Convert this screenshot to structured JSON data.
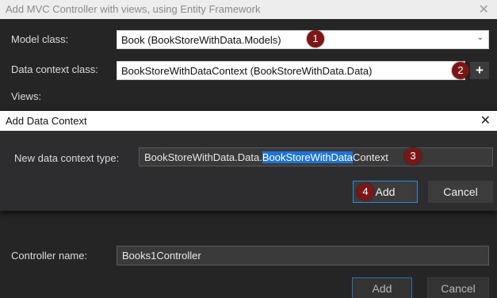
{
  "outer_dialog": {
    "title": "Add MVC Controller with views, using Entity Framework",
    "close_glyph": "✕",
    "model_class_label": "Model class:",
    "model_class_value": "Book (BookStoreWithData.Models)",
    "data_context_label": "Data context class:",
    "data_context_value": "BookStoreWithDataContext (BookStoreWithData.Data)",
    "add_context_glyph": "+",
    "views_label": "Views:",
    "controller_name_label": "Controller name:",
    "controller_name_value": "Books1Controller",
    "add_label": "Add",
    "cancel_label": "Cancel"
  },
  "inner_dialog": {
    "title": "Add Data Context",
    "close_glyph": "✕",
    "type_label": "New data context type:",
    "type_value_prefix": "BookStoreWithData.Data.",
    "type_value_selected": "BookStoreWithData",
    "type_value_suffix": "Context",
    "add_label": "Add",
    "cancel_label": "Cancel"
  },
  "markers": [
    "1",
    "2",
    "3",
    "4"
  ],
  "chevron_glyph": "⌄",
  "icons": {
    "close": "close-icon",
    "dropdown": "chevron-down-icon",
    "add": "plus-icon"
  },
  "colors": {
    "marker": "#7b1616",
    "selection": "#1e73d8",
    "primary_border": "#2f86d6"
  }
}
